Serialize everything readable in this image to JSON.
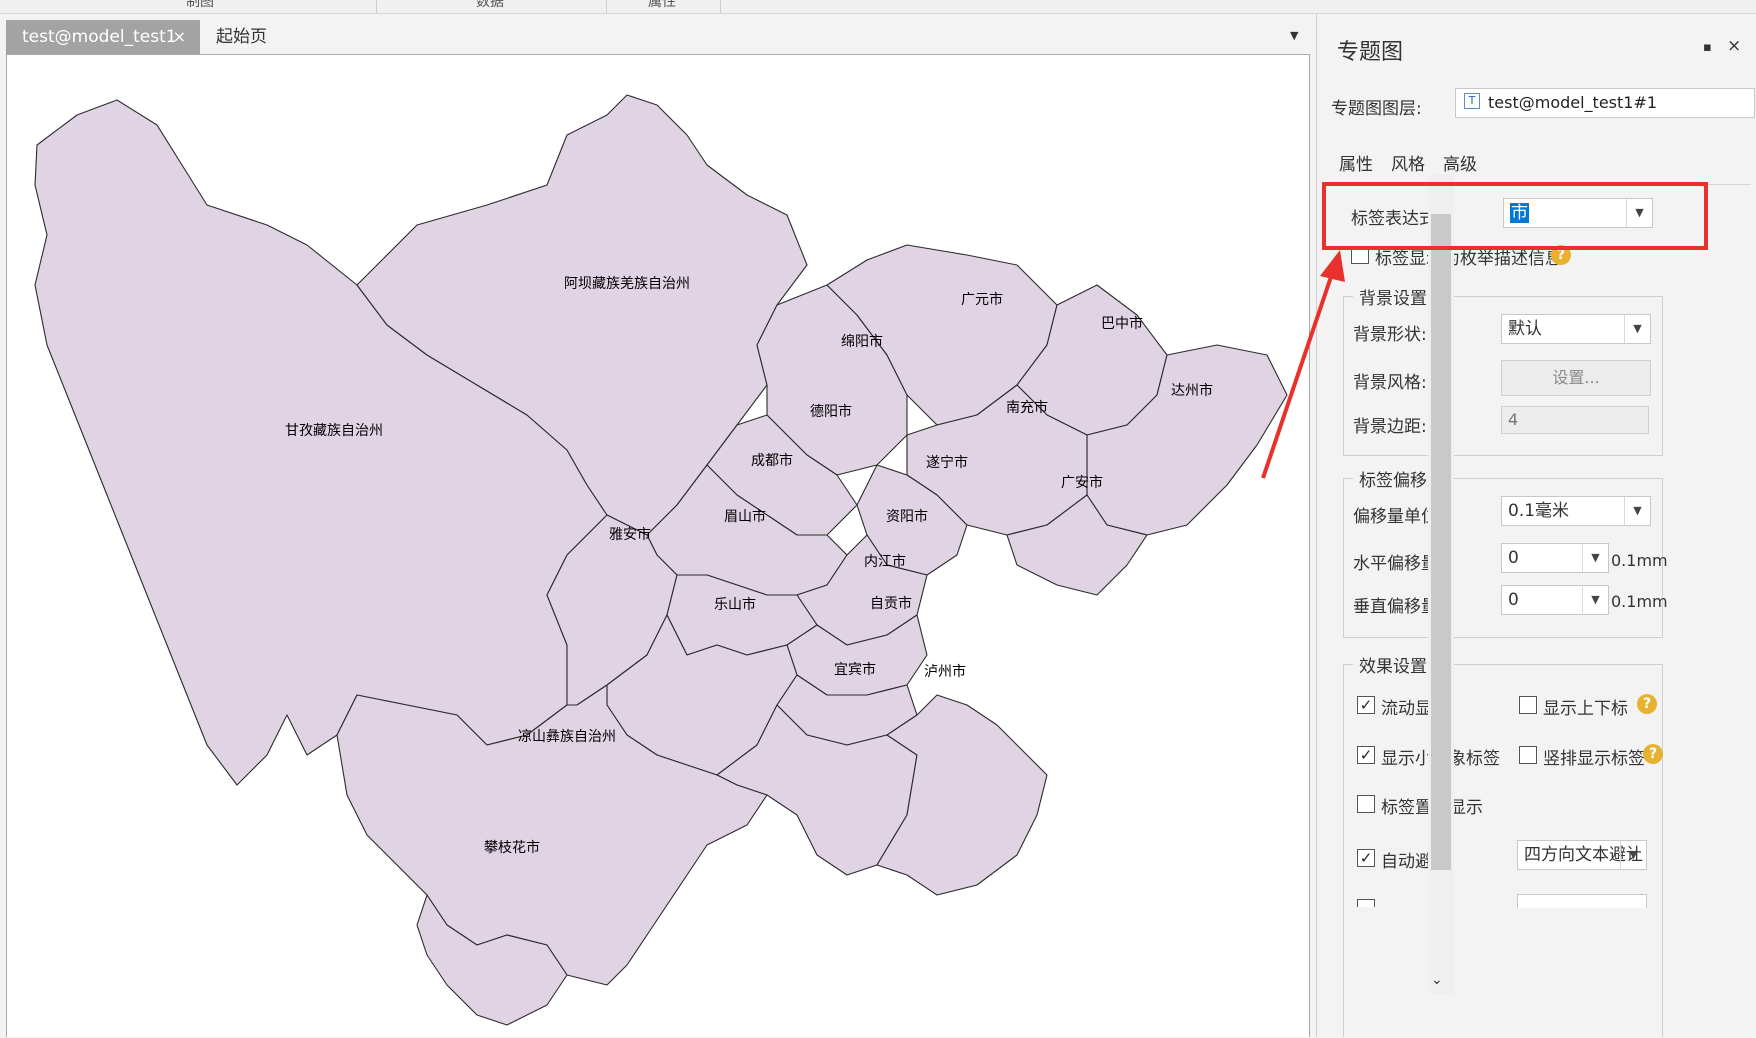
{
  "top_ribbon": {
    "items": [
      "制图",
      "数据",
      "属性"
    ]
  },
  "tabs": {
    "active_label": "test@model_test1",
    "close_glyph": "×",
    "inactive_label": "起始页",
    "dropdown_glyph": "▼"
  },
  "map": {
    "labels": [
      "阿坝藏族羌族自治州",
      "甘孜藏族自治州",
      "凉山彝族自治州",
      "攀枝花市",
      "雅安市",
      "成都市",
      "德阳市",
      "绵阳市",
      "广元市",
      "巴中市",
      "达州市",
      "南充市",
      "广安市",
      "遂宁市",
      "资阳市",
      "眉山市",
      "乐山市",
      "内江市",
      "自贡市",
      "宜宾市",
      "泸州市"
    ],
    "fill_color": "#e0d3e4",
    "stroke_color": "#2b2b2b"
  },
  "panel": {
    "title": "专题图",
    "pin_glyph": "▪",
    "close_glyph": "×",
    "layer_label": "专题图图层:",
    "layer_value": "test@model_test1#1",
    "layer_icon": "T",
    "subtabs": [
      "属性",
      "风格",
      "高级"
    ],
    "label_expr_label": "标签表达式:",
    "label_expr_value": "市",
    "enum_desc_label": "标签显示为枚举描述信息",
    "bg_group": "背景设置",
    "bg_shape_label": "背景形状:",
    "bg_shape_value": "默认",
    "bg_style_label": "背景风格:",
    "bg_style_button": "设置...",
    "bg_margin_label": "背景边距:",
    "bg_margin_value": "4",
    "offset_group": "标签偏移量",
    "offset_unit_label": "偏移量单位:",
    "offset_unit_value": "0.1毫米",
    "h_offset_label": "水平偏移量:",
    "h_offset_value": "0",
    "v_offset_label": "垂直偏移量:",
    "v_offset_value": "0",
    "unit_text": "0.1mm",
    "effect_group": "效果设置",
    "flow_display": "流动显示",
    "show_sub_sup": "显示上下标",
    "show_small_labels": "显示小对象标签",
    "vertical_labels": "竖排显示标签",
    "labels_on_top": "标签置顶显示",
    "auto_avoid": "自动避让",
    "avoid_mode": "四方向文本避让",
    "check_glyph": "✓",
    "help_glyph": "?",
    "arrow_glyph": "▼",
    "scroll_up_glyph": "⌃",
    "scroll_down_glyph": "⌄",
    "accent_color": "#e8312c",
    "highlight_color": "#0078d7"
  }
}
